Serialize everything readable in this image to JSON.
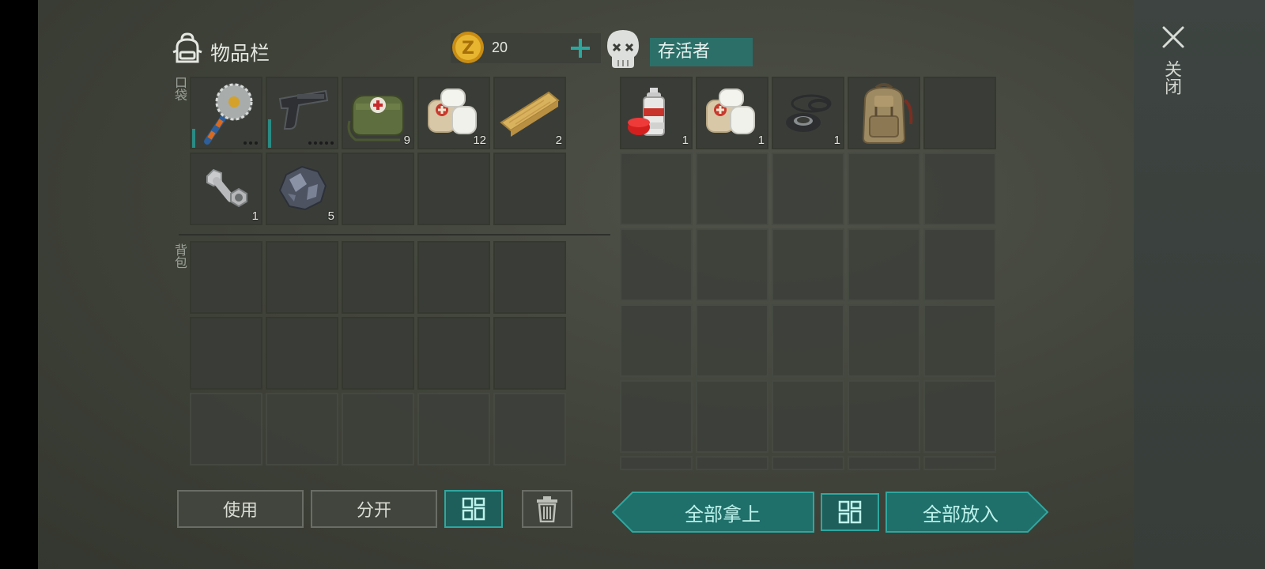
{
  "inventory": {
    "title": "物品栏",
    "coins": "20",
    "pocket_label": "口袋",
    "backpack_label": "背包",
    "pocket_items": [
      {
        "icon": "buzzsaw-mace-icon",
        "qty": "",
        "dots": 3
      },
      {
        "icon": "pistol-icon",
        "qty": "",
        "dots": 5
      },
      {
        "icon": "medkit-bag-icon",
        "qty": "9"
      },
      {
        "icon": "bandage-icon",
        "qty": "12"
      },
      {
        "icon": "wood-plank-icon",
        "qty": "2"
      },
      {
        "icon": "bolt-nut-icon",
        "qty": "1"
      },
      {
        "icon": "iron-ore-icon",
        "qty": "5"
      }
    ]
  },
  "container": {
    "title": "存活者",
    "items": [
      {
        "icon": "spray-paint-icon",
        "qty": "1"
      },
      {
        "icon": "bandage-icon",
        "qty": "1"
      },
      {
        "icon": "rubber-rings-icon",
        "qty": "1"
      },
      {
        "icon": "backpack-icon",
        "qty": ""
      }
    ]
  },
  "buttons": {
    "use": "使用",
    "split": "分开",
    "take_all": "全部拿上",
    "put_all": "全部放入"
  },
  "close_label": "关闭",
  "colors": {
    "accent": "#1f6f6a",
    "accent_border": "#2fa79f",
    "text_teal": "#bff2ec",
    "coin": "#e0a51c"
  }
}
